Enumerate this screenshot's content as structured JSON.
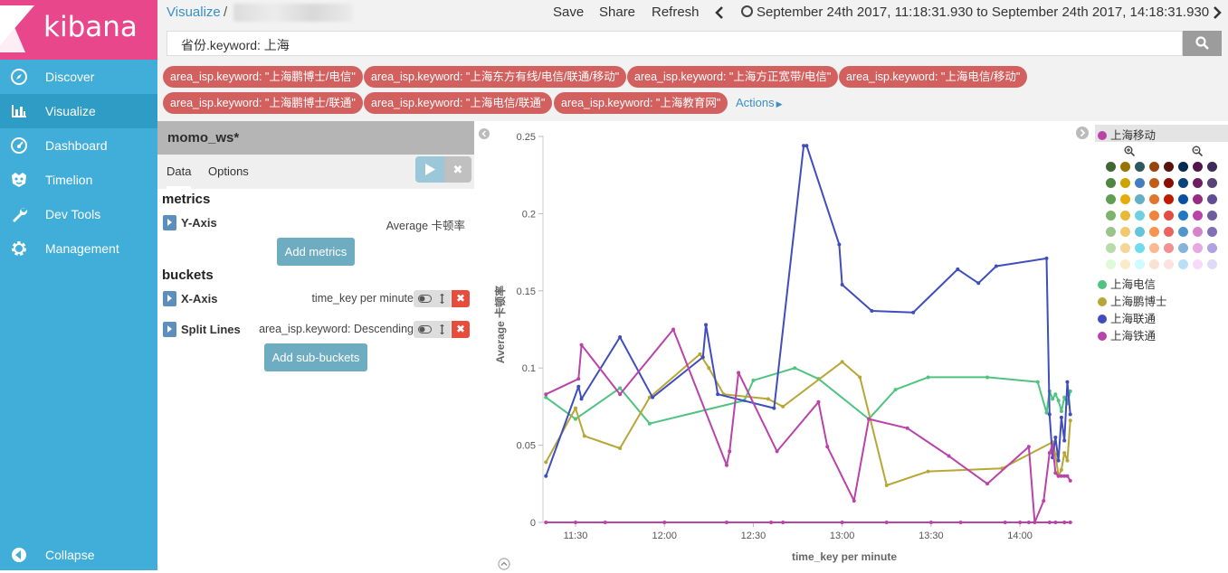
{
  "sidebar": {
    "logo_text": "kibana",
    "items": [
      {
        "label": "Discover",
        "icon": "compass-icon"
      },
      {
        "label": "Visualize",
        "icon": "bar-chart-icon"
      },
      {
        "label": "Dashboard",
        "icon": "gauge-icon"
      },
      {
        "label": "Timelion",
        "icon": "timelion-face-icon"
      },
      {
        "label": "Dev Tools",
        "icon": "wrench-icon"
      },
      {
        "label": "Management",
        "icon": "gear-icon"
      }
    ],
    "collapse_label": "Collapse",
    "active": "Visualize",
    "colors": {
      "bg": "#40aed8",
      "logo_bg": "#e8478b",
      "active": "#2f9cc5"
    }
  },
  "topbar": {
    "breadcrumb_link": "Visualize",
    "breadcrumb_sep": "/",
    "save": "Save",
    "share": "Share",
    "refresh": "Refresh",
    "time_range": "September 24th 2017, 11:18:31.930 to September 24th 2017, 14:18:31.930",
    "query": "省份.keyword: 上海"
  },
  "filters": [
    "area_isp.keyword: \"上海鹏博士/电信\"",
    "area_isp.keyword: \"上海东方有线/电信/联通/移动\"",
    "area_isp.keyword: \"上海方正宽带/电信\"",
    "area_isp.keyword: \"上海电信/移动\"",
    "area_isp.keyword: \"上海鹏博士/联通\"",
    "area_isp.keyword: \"上海电信/联通\"",
    "area_isp.keyword: \"上海教育网\""
  ],
  "filters_actions": "Actions",
  "editor": {
    "title": "momo_ws*",
    "tab_data": "Data",
    "tab_options": "Options",
    "metrics_heading": "metrics",
    "y_axis_label": "Y-Axis",
    "y_axis_desc": "Average 卡顿率",
    "add_metrics": "Add metrics",
    "buckets_heading": "buckets",
    "x_axis_label": "X-Axis",
    "x_axis_desc": "time_key per minute",
    "split_label": "Split Lines",
    "split_desc": "area_isp.keyword: Descending",
    "add_sub_buckets": "Add sub-buckets"
  },
  "legend": {
    "highlighted": "上海移动",
    "items": [
      "上海电信",
      "上海鹏博士",
      "上海联通",
      "上海铁通"
    ]
  },
  "palette": [
    [
      "#3f6833",
      "#967302",
      "#2f575e",
      "#99440a",
      "#58140c",
      "#052b51",
      "#511749",
      "#3f2b5b"
    ],
    [
      "#508642",
      "#cca300",
      "#447ebc",
      "#c15c17",
      "#890f02",
      "#0a437c",
      "#6d1f62",
      "#584477"
    ],
    [
      "#629e51",
      "#e5ac0e",
      "#64b0c8",
      "#e0752d",
      "#bf1b00",
      "#0a50a1",
      "#962d82",
      "#614d93"
    ],
    [
      "#7eb26d",
      "#eab839",
      "#6ed0e0",
      "#ef843c",
      "#e24d42",
      "#1f78c1",
      "#ba43a9",
      "#705da0"
    ],
    [
      "#9ac48a",
      "#f2c96d",
      "#65c5db",
      "#f9934e",
      "#ea6460",
      "#5195ce",
      "#d683ce",
      "#806eb7"
    ],
    [
      "#b7dbab",
      "#f4d598",
      "#70dbed",
      "#f9ba8f",
      "#f29191",
      "#82b5d8",
      "#e5a8e2",
      "#aea2e0"
    ],
    [
      "#e0f9d7",
      "#fceaca",
      "#cffaff",
      "#f9e2d2",
      "#fce2de",
      "#badff4",
      "#f9d9f9",
      "#dedaf7"
    ]
  ],
  "chart_data": {
    "type": "line",
    "xlabel": "time_key per minute",
    "ylabel": "Average 卡顿率",
    "x_ticks": [
      "11:30",
      "12:00",
      "12:30",
      "13:00",
      "13:30",
      "14:00"
    ],
    "x_tick_minutes": [
      690,
      720,
      750,
      780,
      810,
      840
    ],
    "xlim_minutes": [
      679,
      858
    ],
    "y_ticks": [
      "0",
      "0.05",
      "0.1",
      "0.15",
      "0.2",
      "0.25"
    ],
    "ylim": [
      0,
      0.25
    ],
    "series": [
      {
        "name": "上海移动",
        "color": "#ba43a9",
        "x": [
          680,
          690,
          700,
          720,
          741,
          756,
          760,
          780,
          795,
          810,
          820,
          835,
          840,
          843,
          850,
          852,
          855,
          857
        ],
        "y": [
          0,
          0,
          0,
          0,
          0,
          0,
          0,
          0,
          0,
          0,
          0,
          0,
          0,
          0,
          0,
          0,
          0,
          0
        ]
      },
      {
        "name": "上海电信",
        "color": "#4fc37f",
        "x": [
          680,
          690,
          705,
          715,
          747,
          750,
          764,
          772,
          789,
          798,
          809,
          829,
          846,
          849,
          850,
          851,
          852,
          853,
          854,
          855,
          856,
          857
        ],
        "y": [
          0.081,
          0.067,
          0.087,
          0.064,
          0.079,
          0.092,
          0.1,
          0.093,
          0.067,
          0.086,
          0.094,
          0.094,
          0.091,
          0.071,
          0.085,
          0.08,
          0.083,
          0.079,
          0.072,
          0.081,
          0.077,
          0.085
        ]
      },
      {
        "name": "上海鹏博士",
        "color": "#b8a636",
        "x": [
          680,
          690,
          693,
          705,
          715,
          732,
          735,
          740,
          755,
          760,
          780,
          786,
          795,
          809,
          834,
          851,
          852,
          853,
          854,
          855,
          856,
          857
        ],
        "y": [
          0.039,
          0.074,
          0.056,
          0.048,
          0.081,
          0.109,
          0.1,
          0.083,
          0.08,
          0.075,
          0.104,
          0.094,
          0.024,
          0.033,
          0.035,
          0.052,
          0.044,
          0.03,
          0.034,
          0.045,
          0.04,
          0.066
        ]
      },
      {
        "name": "上海联通",
        "color": "#3f4dbd",
        "x": [
          680,
          691,
          692,
          705,
          716,
          733,
          734,
          738,
          757,
          767,
          768,
          779,
          780,
          790,
          804,
          819,
          826,
          832,
          849,
          850,
          851,
          852,
          853,
          854,
          855,
          856,
          857
        ],
        "y": [
          0.03,
          0.088,
          0.08,
          0.12,
          0.081,
          0.107,
          0.128,
          0.083,
          0.074,
          0.244,
          0.244,
          0.18,
          0.154,
          0.137,
          0.136,
          0.164,
          0.155,
          0.166,
          0.171,
          0.07,
          0.042,
          0.055,
          0.04,
          0.068,
          0.053,
          0.091,
          0.07
        ]
      },
      {
        "name": "上海铁通",
        "color": "#ba43a9",
        "x": [
          680,
          691,
          692,
          705,
          723,
          741,
          742,
          745,
          758,
          772,
          775,
          784,
          789,
          802,
          816,
          829,
          843,
          845,
          848,
          850,
          851,
          852,
          853,
          854,
          855,
          856,
          857
        ],
        "y": [
          0.083,
          0.093,
          0.115,
          0.083,
          0.125,
          0.037,
          0.046,
          0.097,
          0.046,
          0.078,
          0.049,
          0.014,
          0.067,
          0.061,
          0.043,
          0.025,
          0.049,
          0.0,
          0.014,
          0.045,
          0.05,
          0.032,
          0.03,
          0.03,
          0.03,
          0.03,
          0.027
        ]
      }
    ]
  }
}
